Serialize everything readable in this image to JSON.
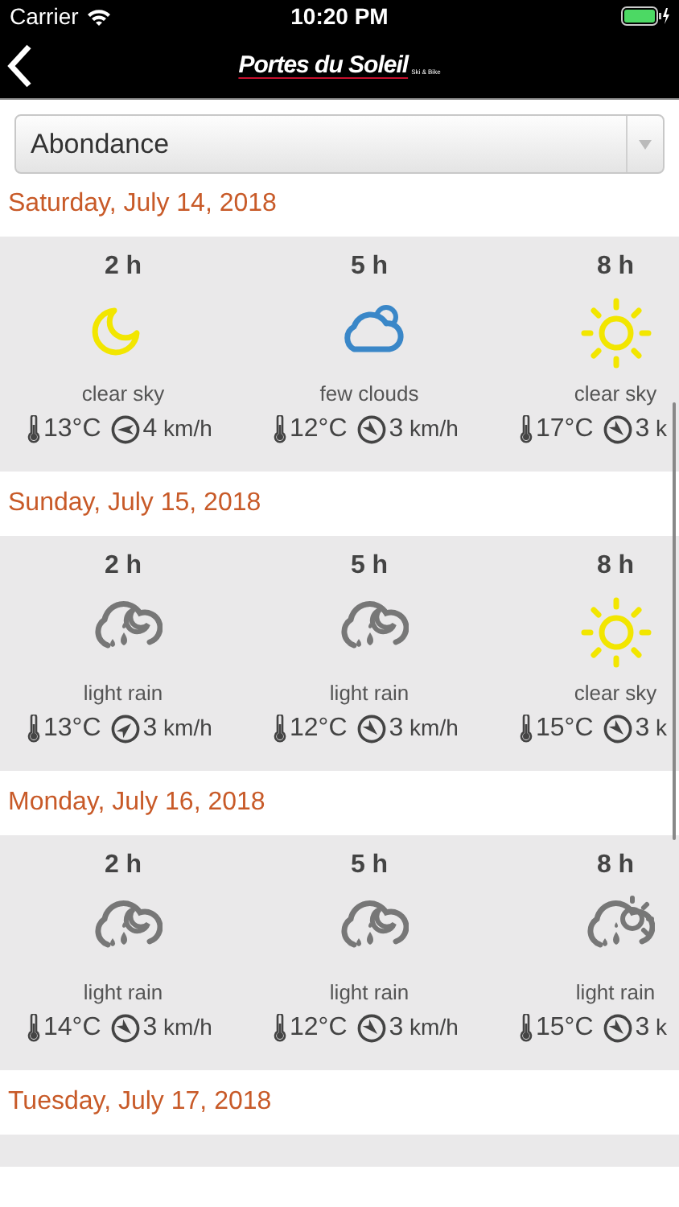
{
  "status_bar": {
    "carrier": "Carrier",
    "time": "10:20 PM"
  },
  "nav": {
    "logo": "Portes du Soleil",
    "logo_tagline": "Ski & Bike"
  },
  "location_select": {
    "value": "Abondance"
  },
  "days": [
    {
      "date": "Saturday, July 14, 2018",
      "hours": [
        {
          "hour": "2 h",
          "kind": "moon",
          "condition": "clear sky",
          "temp": "13°C",
          "wind_arrow": {
            "kind": "w"
          },
          "wind": "4 km/h"
        },
        {
          "hour": "5 h",
          "kind": "few-clouds",
          "condition": "few clouds",
          "temp": "12°C",
          "wind_arrow": {
            "kind": "se"
          },
          "wind": "3 km/h"
        },
        {
          "hour": "8 h",
          "kind": "sun",
          "condition": "clear sky",
          "temp": "17°C",
          "wind_arrow": {
            "kind": "se"
          },
          "wind": "3 k"
        }
      ]
    },
    {
      "date": "Sunday, July 15, 2018",
      "hours": [
        {
          "hour": "2 h",
          "kind": "rain-night",
          "condition": "light rain",
          "temp": "13°C",
          "wind_arrow": {
            "kind": "ne"
          },
          "wind": "3 km/h"
        },
        {
          "hour": "5 h",
          "kind": "rain-night",
          "condition": "light rain",
          "temp": "12°C",
          "wind_arrow": {
            "kind": "se"
          },
          "wind": "3 km/h"
        },
        {
          "hour": "8 h",
          "kind": "sun",
          "condition": "clear sky",
          "temp": "15°C",
          "wind_arrow": {
            "kind": "se"
          },
          "wind": "3 k"
        }
      ]
    },
    {
      "date": "Monday, July 16, 2018",
      "hours": [
        {
          "hour": "2 h",
          "kind": "rain-night",
          "condition": "light rain",
          "temp": "14°C",
          "wind_arrow": {
            "kind": "se"
          },
          "wind": "3 km/h"
        },
        {
          "hour": "5 h",
          "kind": "rain-night",
          "condition": "light rain",
          "temp": "12°C",
          "wind_arrow": {
            "kind": "se"
          },
          "wind": "3 km/h"
        },
        {
          "hour": "8 h",
          "kind": "rain-day",
          "condition": "light rain",
          "temp": "15°C",
          "wind_arrow": {
            "kind": "se"
          },
          "wind": "3 k"
        }
      ]
    },
    {
      "date": "Tuesday, July 17, 2018"
    }
  ]
}
